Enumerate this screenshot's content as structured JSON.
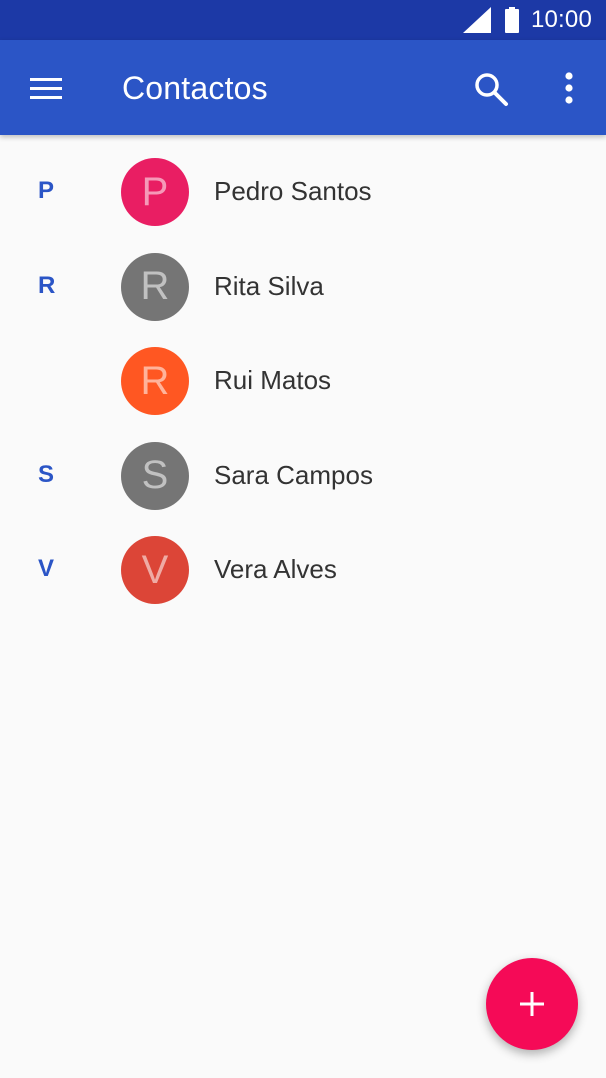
{
  "status_bar": {
    "time": "10:00",
    "icons": [
      "signal-icon",
      "battery-icon"
    ]
  },
  "app_bar": {
    "title": "Contactos",
    "icons": [
      "menu-icon",
      "search-icon",
      "more-vert-icon"
    ]
  },
  "contacts": [
    {
      "section": "P",
      "initial": "P",
      "name": "Pedro Santos",
      "color": "#e91e63"
    },
    {
      "section": "R",
      "initial": "R",
      "name": "Rita Silva",
      "color": "#757575"
    },
    {
      "section": "",
      "initial": "R",
      "name": "Rui Matos",
      "color": "#ff5722"
    },
    {
      "section": "S",
      "initial": "S",
      "name": "Sara Campos",
      "color": "#757575"
    },
    {
      "section": "V",
      "initial": "V",
      "name": "Vera Alves",
      "color": "#dc4537"
    }
  ],
  "fab": {
    "icon": "add-icon"
  },
  "colors": {
    "status_bar": "#1c39a6",
    "app_bar": "#2b55c6",
    "fab": "#f50a57",
    "background": "#fafafa"
  }
}
